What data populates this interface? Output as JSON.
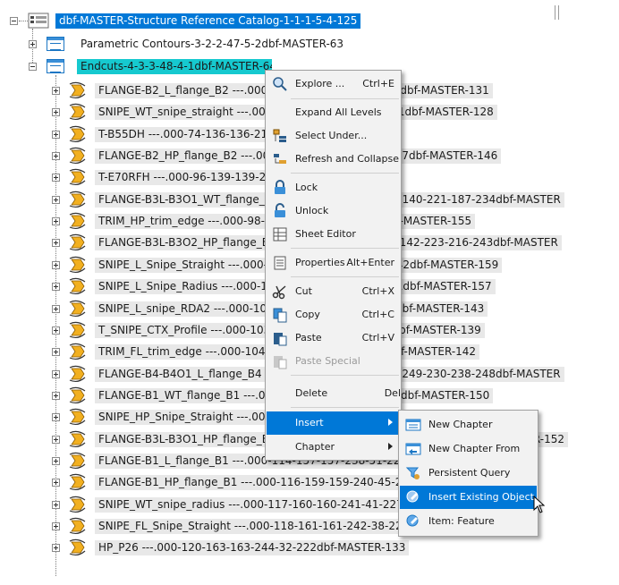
{
  "tree": {
    "root": "dbf-MASTER-Structure Reference Catalog-1-1-1-5-4-125",
    "chapters": [
      "Parametric Contours-3-2-2-47-5-2dbf-MASTER-63",
      "Endcuts-4-3-3-48-4-1dbf-MASTER-64"
    ],
    "items": [
      "FLANGE-B2_L_flange_B2 ---.000-73-135-135-215-32-232dbf-MASTER-131",
      "SNIPE_WT_snipe_straight ---.000-75-137-137-217-35-231dbf-MASTER-128",
      "T-B55DH ---.000-74-136-136-216-34-149",
      "FLANGE-B2_HP_flange_B2 ---.000-76-138-138-218-36-237dbf-MASTER-146",
      "T-E70RFH ---.000-96-139-139-219-37-140",
      "FLANGE-B3L-B3O1_WT_flange_B3L-B3O1 ---.000-97-140-140-221-187-234dbf-MASTER",
      "TRIM_HP_trim_edge ---.000-98-141-141-222-188-233dbf-MASTER-155",
      "FLANGE-B3L-B3O2_HP_flange_B3L-B3O2 ---.000-99-142-142-223-216-243dbf-MASTER",
      "SNIPE_L_Snipe_Straight ---.000-100-143-143-224-217-242dbf-MASTER-159",
      "SNIPE_L_Snipe_Radius ---.000-101-144-144-225-218-241dbf-MASTER-157",
      "SNIPE_L_snipe_RDA2 ---.000-102-145-145-226-219-240dbf-MASTER-143",
      "T_SNIPE_CTX_Profile ---.000-103-146-146-227-220-239dbf-MASTER-139",
      "TRIM_FL_trim_edge ---.000-104-147-147-228-221-238dbf-MASTER-142",
      "FLANGE-B4-B4O1_L_flange_B4 ---.000-105-148-148-229-249-230-238-248dbf-MASTER",
      "FLANGE-B1_WT_flange_B1 ---.000-106-149-149-230-250dbf-MASTER-150",
      "SNIPE_HP_Snipe_Straight ---.000-107-150-150-231-251dbf-MASTER-151",
      "FLANGE-B3L-B3O1_HP_flange_B3L-B3O1 ---.000-112-155-155-236-252dbf-MASTER-152",
      "FLANGE-B1_L_flange_B1 ---.000-114-157-157-238-51-226dbf-MASTER-153",
      "FLANGE-B1_HP_flange_B1 ---.000-116-159-159-240-45-229dbf-MASTER-141",
      "SNIPE_WT_snipe_radius ---.000-117-160-160-241-41-227dbf-MASTER-137",
      "SNIPE_FL_Snipe_Straight ---.000-118-161-161-242-38-224dbf-MASTER-154",
      "HP_P26 ---.000-120-163-163-244-32-222dbf-MASTER-133"
    ]
  },
  "context_menu": {
    "items": [
      {
        "label": "Explore ...",
        "shortcut": "Ctrl+E",
        "icon": "explore-icon"
      },
      {
        "label": "Expand All Levels",
        "shortcut": "",
        "icon": ""
      },
      {
        "label": "Select Under...",
        "shortcut": "",
        "icon": "select-under-icon"
      },
      {
        "label": "Refresh and Collapse",
        "shortcut": "",
        "icon": "refresh-collapse-icon"
      },
      {
        "label": "Lock",
        "shortcut": "",
        "icon": "lock-icon"
      },
      {
        "label": "Unlock",
        "shortcut": "",
        "icon": "unlock-icon"
      },
      {
        "label": "Sheet Editor",
        "shortcut": "",
        "icon": "sheet-editor-icon"
      },
      {
        "label": "Properties",
        "shortcut": "Alt+Enter",
        "icon": "properties-icon"
      },
      {
        "label": "Cut",
        "shortcut": "Ctrl+X",
        "icon": "scissors-icon"
      },
      {
        "label": "Copy",
        "shortcut": "Ctrl+C",
        "icon": "copy-icon"
      },
      {
        "label": "Paste",
        "shortcut": "Ctrl+V",
        "icon": "paste-icon"
      },
      {
        "label": "Paste Special",
        "shortcut": "",
        "icon": "paste-special-icon"
      },
      {
        "label": "Delete",
        "shortcut": "Del",
        "icon": ""
      },
      {
        "label": "Insert",
        "shortcut": "",
        "icon": ""
      },
      {
        "label": "Chapter",
        "shortcut": "",
        "icon": ""
      }
    ]
  },
  "submenu": {
    "items": [
      {
        "label": "New Chapter",
        "icon": "new-chapter-icon"
      },
      {
        "label": "New Chapter From",
        "icon": "new-chapter-from-icon"
      },
      {
        "label": "Persistent Query",
        "icon": "persistent-query-icon"
      },
      {
        "label": "Insert Existing Object",
        "icon": "insert-existing-object-icon"
      },
      {
        "label": "Item: Feature",
        "icon": "item-feature-icon"
      }
    ]
  },
  "colors": {
    "selection": "#0078d7",
    "highlight_cyan": "#16c9cf",
    "row_background": "#e8e8e8",
    "menu_background": "#f2f2f2"
  }
}
